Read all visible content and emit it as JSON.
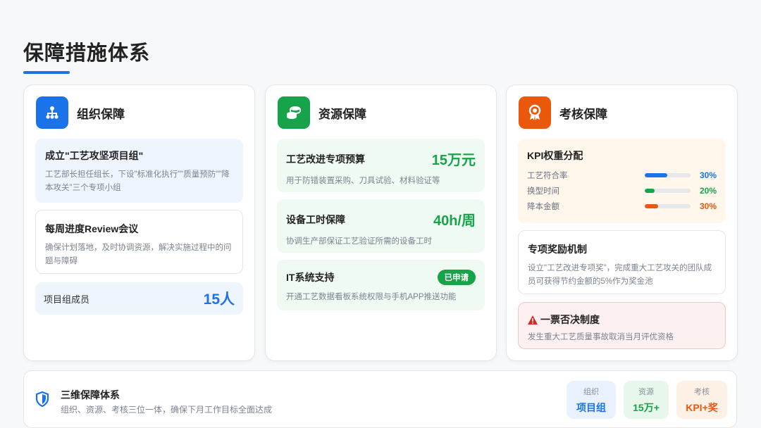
{
  "page": {
    "title": "保障措施体系"
  },
  "cards": {
    "org": {
      "title": "组织保障",
      "item1": {
        "title": "成立\"工艺攻坚项目组\"",
        "desc": "工艺部长担任组长，下设\"标准化执行\"\"质量预防\"\"降本攻关\"三个专项小组"
      },
      "item2": {
        "title": "每周进度Review会议",
        "desc": "确保计划落地，及时协调资源，解决实施过程中的问题与障碍"
      },
      "members": {
        "label": "项目组成员",
        "value": "15人"
      }
    },
    "resource": {
      "title": "资源保障",
      "budget": {
        "title": "工艺改进专项预算",
        "value": "15万元",
        "desc": "用于防错装置采购、刀具试验、材料验证等"
      },
      "hours": {
        "title": "设备工时保障",
        "value": "40h/周",
        "desc": "协调生产部保证工艺验证所需的设备工时"
      },
      "it": {
        "title": "IT系统支持",
        "badge": "已申请",
        "desc": "开通工艺数据看板系统权限与手机APP推送功能"
      }
    },
    "assess": {
      "title": "考核保障",
      "kpi": {
        "title": "KPI权重分配",
        "rows": [
          {
            "label": "工艺符合率",
            "value": "30%",
            "fraction": 0.5,
            "color": "#1a73e8"
          },
          {
            "label": "换型时间",
            "value": "20%",
            "fraction": 0.22,
            "color": "#16a34a"
          },
          {
            "label": "降本金额",
            "value": "30%",
            "fraction": 0.3,
            "color": "#ea580c"
          }
        ]
      },
      "reward": {
        "title": "专项奖励机制",
        "desc": "设立\"工艺改进专项奖\"，完成重大工艺攻关的团队成员可获得节约金额的5%作为奖金池"
      },
      "veto": {
        "title": "一票否决制度",
        "desc": "发生重大工艺质量事故取消当月评优资格"
      }
    }
  },
  "bottom": {
    "title": "三维保障体系",
    "desc": "组织、资源、考核三位一体，确保下月工作目标全面达成",
    "chips": [
      {
        "label": "组织",
        "value": "项目组",
        "color": "#1a73e8",
        "bg": "#e8f1fd"
      },
      {
        "label": "资源",
        "value": "15万+",
        "color": "#16a34a",
        "bg": "#e8f7ec"
      },
      {
        "label": "考核",
        "value": "KPI+奖",
        "color": "#ea580c",
        "bg": "#fdf1e6"
      }
    ]
  }
}
